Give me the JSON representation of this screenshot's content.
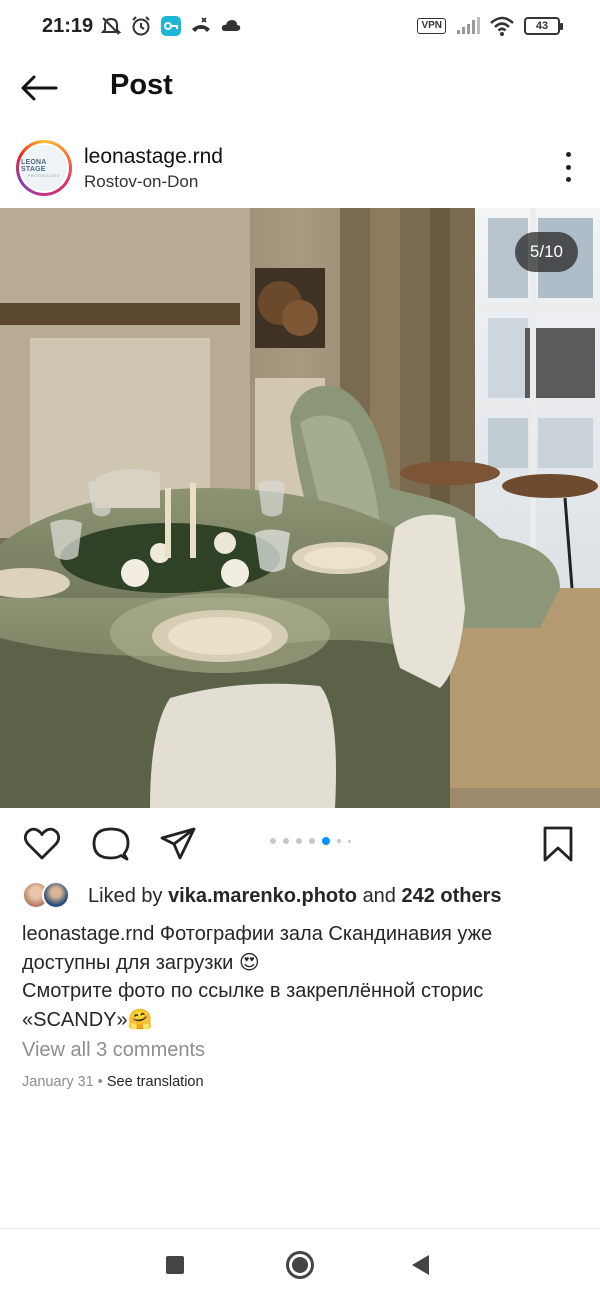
{
  "status_bar": {
    "time": "21:19",
    "vpn": "VPN",
    "battery": "43",
    "icons": [
      "mute-icon",
      "alarm-icon",
      "key-icon",
      "phone-icon",
      "cloud-icon",
      "signal-icon",
      "wifi-icon",
      "battery-icon"
    ]
  },
  "header": {
    "title": "Post",
    "back_icon": "arrow-left-icon"
  },
  "post": {
    "username": "leonastage.rnd",
    "location": "Rostov-on-Don",
    "avatar_text": "LEONA STAGE",
    "avatar_subtext": "PHOTOSTUDIO",
    "photo_counter": "5/10",
    "likes_prefix": "Liked by",
    "liked_by_user": "vika.marenko.photo",
    "likes_and": "and",
    "likes_others": "242 others",
    "caption_user": "leonastage.rnd",
    "caption_line1": "Фотографии зала Скандинавия уже доступны для загрузки 😍",
    "caption_line2": "Смотрите фото по ссылке в закреплённой сторис «SCANDY»🤗",
    "view_comments": "View all 3 comments",
    "date": "January 31",
    "separator": "•",
    "see_translation": "See translation"
  },
  "carousel": {
    "total": 10,
    "current": 5
  },
  "colors": {
    "accent_blue": "#0095f6",
    "text_primary": "#262626",
    "text_secondary": "#8e8e8e"
  }
}
